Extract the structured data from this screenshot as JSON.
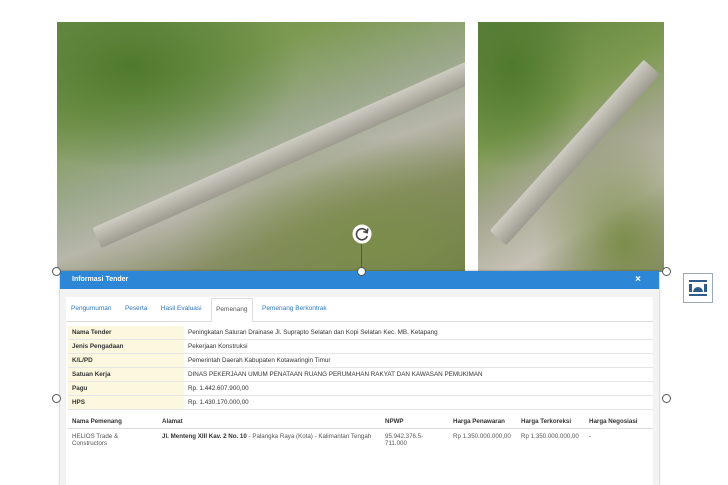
{
  "dialog": {
    "title": "Informasi Tender",
    "close_label": "×",
    "tabs": [
      {
        "label": "Pengumuman"
      },
      {
        "label": "Peserta"
      },
      {
        "label": "Hasil Evaluasi"
      },
      {
        "label": "Pemenang"
      },
      {
        "label": "Pemenang Berkontrak"
      }
    ],
    "active_tab": "Pemenang",
    "info_rows": [
      {
        "key": "Nama Tender",
        "value": "Peningkatan Saluran Drainase Jl. Suprapto Selatan dan Kopi Selatan Kec. MB. Ketapang"
      },
      {
        "key": "Jenis Pengadaan",
        "value": "Pekerjaan Konstruksi"
      },
      {
        "key": "K/L/PD",
        "value": "Pemerintah Daerah Kabupaten Kotawaringin Timur"
      },
      {
        "key": "Satuan Kerja",
        "value": "DINAS PEKERJAAN UMUM PENATAAN RUANG PERUMAHAN RAKYAT DAN KAWASAN PEMUKIMAN"
      },
      {
        "key": "Pagu",
        "value": "Rp. 1.442.607.900,00"
      },
      {
        "key": "HPS",
        "value": "Rp. 1.430.170.000,00"
      }
    ],
    "winners": {
      "headers": [
        "Nama Pemenang",
        "Alamat",
        "NPWP",
        "Harga Penawaran",
        "Harga Terkoreksi",
        "Harga Negosiasi"
      ],
      "rows": [
        {
          "name": "HELIOS Trade & Constructors",
          "address_bold": "Jl. Menteng XIII Kav. 2 No. 10",
          "address_rest": " - Palangka Raya (Kota) - Kalimantan Tengah",
          "npwp": "95.942.376.5-711.000",
          "offer": "Rp 1.350.000.000,00",
          "corrected": "Rp 1.350.000.000,00",
          "negotiated": "-"
        }
      ]
    }
  }
}
